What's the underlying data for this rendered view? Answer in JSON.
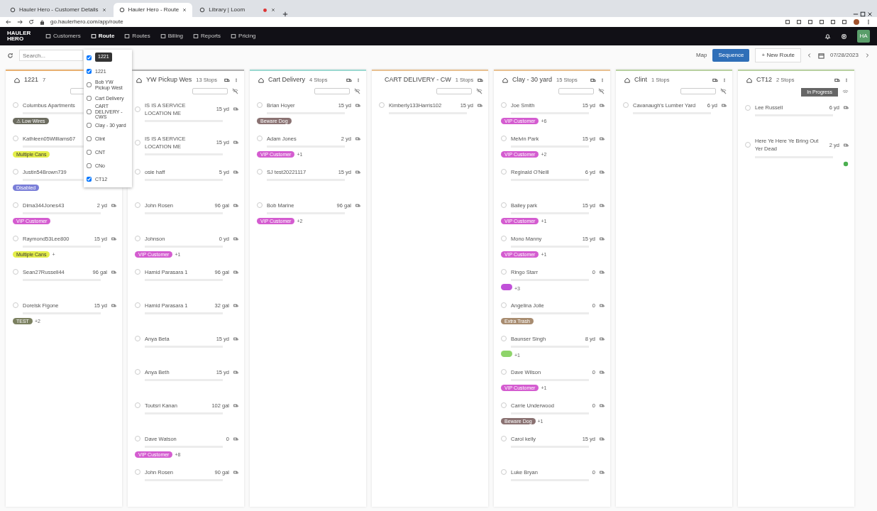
{
  "browser": {
    "tabs": [
      {
        "title": "Hauler Hero - Customer Details",
        "selected": false
      },
      {
        "title": "Hauler Hero - Route",
        "selected": true
      },
      {
        "title": "Library | Loom",
        "selected": false,
        "recording": true
      }
    ],
    "url": "go.haulerhero.com/app/route"
  },
  "app_nav": {
    "logo": "HAULER HERO",
    "items": [
      {
        "label": "Customers",
        "selected": false
      },
      {
        "label": "Route",
        "selected": true
      },
      {
        "label": "Routes",
        "selected": false
      },
      {
        "label": "Billing",
        "selected": false
      },
      {
        "label": "Reports",
        "selected": false
      },
      {
        "label": "Pricing",
        "selected": false
      }
    ],
    "avatar": "HA"
  },
  "toolbar": {
    "search_placeholder": "Search...",
    "map_label": "Map",
    "sequence_button": "Sequence",
    "new_route_button": "+ New Route",
    "date": "07/28/2023"
  },
  "route_filter": {
    "tooltip": "1221",
    "items": [
      {
        "checked": true
      },
      {
        "label": "1221",
        "checked": true
      },
      {
        "label": "Bob YW Pickup West",
        "checked": false
      },
      {
        "label": "Cart Delivery",
        "checked": false
      },
      {
        "label": "CART DELIVERY - CWS",
        "checked": false
      },
      {
        "label": "Clay - 30 yard",
        "checked": false
      },
      {
        "label": "Clint",
        "checked": false
      },
      {
        "label": "CNT",
        "checked": false
      },
      {
        "label": "CNo",
        "checked": false
      },
      {
        "label": "CT12",
        "checked": true
      }
    ]
  },
  "columns": [
    {
      "title": "1221",
      "stops": "7",
      "color": "#e8b070",
      "cards": [
        {
          "name": "Columbus Apartments",
          "tags": [
            {
              "label": "⚠ Low Wires",
              "color": "#6c6c60"
            }
          ]
        },
        {
          "name": "Kathleen05Williams67",
          "tags": [
            {
              "label": "Multiple Cans",
              "color": "#e4ee4a"
            }
          ]
        },
        {
          "name": "Justin54Brown739",
          "tags": [
            {
              "label": "Disabled",
              "color": "#7a7ed8"
            }
          ]
        },
        {
          "name": "Dima344Jones43",
          "size": "2 yd",
          "tags": [
            {
              "label": "VIP Customer",
              "color": "#d45cd0"
            }
          ]
        },
        {
          "name": "Raymond53Lee800",
          "size": "15 yd",
          "tags": [
            {
              "label": "Multiple Cans",
              "color": "#e4ee4a"
            }
          ],
          "more": "+"
        },
        {
          "name": "Sean27Russell44",
          "size": "96 gal"
        },
        {
          "name": "Dorelsk Figone",
          "size": "15 yd",
          "tags": [
            {
              "label": "TEST",
              "color": "#7b8060"
            }
          ],
          "more": "+2"
        }
      ]
    },
    {
      "title": "YW Pickup Wes",
      "stops": "13 Stops",
      "color": "#b0b0b0",
      "cards": [
        {
          "name": "IS IS A SERVICE LOCATION ME",
          "size": "15 yd"
        },
        {
          "name": "IS IS A SERVICE LOCATION ME",
          "size": "15 yd"
        },
        {
          "name": "osie haff",
          "size": "5 yd"
        },
        {
          "name": "John Rosen",
          "size": "96 gal"
        },
        {
          "name": "Johnson",
          "size": "0 yd",
          "tags": [
            {
              "label": "VIP Customer",
              "color": "#d45cd0"
            }
          ],
          "more": "+1"
        },
        {
          "name": "Hamid Parasara 1",
          "size": "96 gal"
        },
        {
          "name": "Hamid Parasara 1",
          "size": "32 gal"
        },
        {
          "name": "Anya Beta",
          "size": "15 yd"
        },
        {
          "name": "Anya Beth",
          "size": "15 yd"
        },
        {
          "name": "Toutsri Kanan",
          "size": "102 gal"
        },
        {
          "name": "Dave Watson",
          "size": "0",
          "tags": [
            {
              "label": "VIP Customer",
              "color": "#d45cd0"
            }
          ],
          "more": "+8"
        },
        {
          "name": "John Rosen",
          "size": "90 gal"
        }
      ]
    },
    {
      "title": "Cart Delivery",
      "stops": "4 Stops",
      "color": "#9ad8d0",
      "cards": [
        {
          "name": "Brian Hoyer",
          "size": "15 yd",
          "tags": [
            {
              "label": "Beware Dog",
              "color": "#8a7272"
            }
          ]
        },
        {
          "name": "Adam Jones",
          "size": "2 yd",
          "tags": [
            {
              "label": "VIP Customer",
              "color": "#d45cd0"
            }
          ],
          "more": "+1"
        },
        {
          "name": "SJ test20221117",
          "size": "15 yd"
        },
        {
          "name": "Bob Marine",
          "size": "96 gal",
          "tags": [
            {
              "label": "VIP Customer",
              "color": "#d45cd0"
            }
          ],
          "more": "+2"
        }
      ]
    },
    {
      "title": "CART DELIVERY - CW",
      "stops": "1 Stops",
      "color": "#e8c090",
      "cards": [
        {
          "name": "Kimberly133Harris102",
          "size": "15 yd"
        }
      ]
    },
    {
      "title": "Clay - 30 yard",
      "stops": "15 Stops",
      "color": "#e8c090",
      "cards": [
        {
          "name": "Joe Smith",
          "size": "15 yd",
          "tags": [
            {
              "label": "VIP Customer",
              "color": "#d45cd0"
            }
          ],
          "more": "+6"
        },
        {
          "name": "Melvin Park",
          "size": "15 yd",
          "tags": [
            {
              "label": "VIP Customer",
              "color": "#d45cd0"
            }
          ],
          "more": "+2"
        },
        {
          "name": "Reginald O'Neill",
          "size": "6 yd"
        },
        {
          "name": "Bailey park",
          "size": "15 yd",
          "tags": [
            {
              "label": "VIP Customer",
              "color": "#d45cd0"
            }
          ],
          "more": "+1"
        },
        {
          "name": "Mono Manny",
          "size": "15 yd",
          "tags": [
            {
              "label": "VIP Customer",
              "color": "#d45cd0"
            }
          ],
          "more": "+1"
        },
        {
          "name": "Ringo Starr",
          "size": "0",
          "tags": [
            {
              "color": "#c050d8"
            }
          ],
          "more": "+3"
        },
        {
          "name": "Angelina Jolie",
          "size": "0",
          "tags": [
            {
              "label": "Extra Trash",
              "color": "#a88c70"
            }
          ]
        },
        {
          "name": "Baunser Singh",
          "size": "8 yd",
          "tags": [
            {
              "color": "#8ed46a"
            }
          ],
          "more": "+1"
        },
        {
          "name": "Dave Wilson",
          "size": "0",
          "tags": [
            {
              "label": "VIP Customer",
              "color": "#d45cd0"
            }
          ],
          "more": "+1"
        },
        {
          "name": "Carrie Underwood",
          "size": "0",
          "tags": [
            {
              "label": "Beware Dog",
              "color": "#8a7272"
            }
          ],
          "more": "+1"
        },
        {
          "name": "Carol kelly",
          "size": "15 yd"
        },
        {
          "name": "Luke Bryan",
          "size": "0"
        }
      ]
    },
    {
      "title": "Clint",
      "stops": "1 Stops",
      "color": "#b8d0a0",
      "cards": [
        {
          "name": "Cavanaugh's Lumber Yard",
          "size": "6 yd"
        }
      ]
    },
    {
      "title": "CT12",
      "stops": "2 Stops",
      "color": "#b8d0a0",
      "status": "In Progress",
      "cards": [
        {
          "name": "Lee Russell",
          "size": "6 yd"
        },
        {
          "name": "Here Ye Here Ye Bring Out Yer Dead",
          "size": "2 yd",
          "done": true
        }
      ]
    }
  ]
}
